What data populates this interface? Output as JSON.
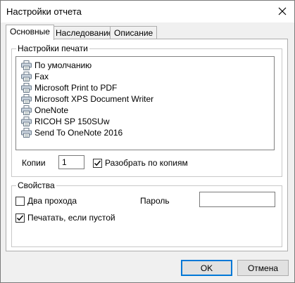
{
  "window": {
    "title": "Настройки отчета"
  },
  "tabs": [
    {
      "label": "Основные",
      "active": true
    },
    {
      "label": "Наследование",
      "active": false
    },
    {
      "label": "Описание",
      "active": false
    }
  ],
  "print_settings": {
    "label": "Настройки печати",
    "printers": [
      "По умолчанию",
      "Fax",
      "Microsoft Print to PDF",
      "Microsoft XPS Document Writer",
      "OneNote",
      "RICOH SP 150SUw",
      "Send To OneNote 2016"
    ],
    "copies_label": "Копии",
    "copies_value": "1",
    "collate_label": "Разобрать по копиям",
    "collate_checked": true
  },
  "properties": {
    "label": "Свойства",
    "two_pass_label": "Два прохода",
    "two_pass_checked": false,
    "password_label": "Пароль",
    "password_value": "",
    "print_if_empty_label": "Печатать, если пустой",
    "print_if_empty_checked": true
  },
  "buttons": {
    "ok": "OK",
    "cancel": "Отмена"
  }
}
